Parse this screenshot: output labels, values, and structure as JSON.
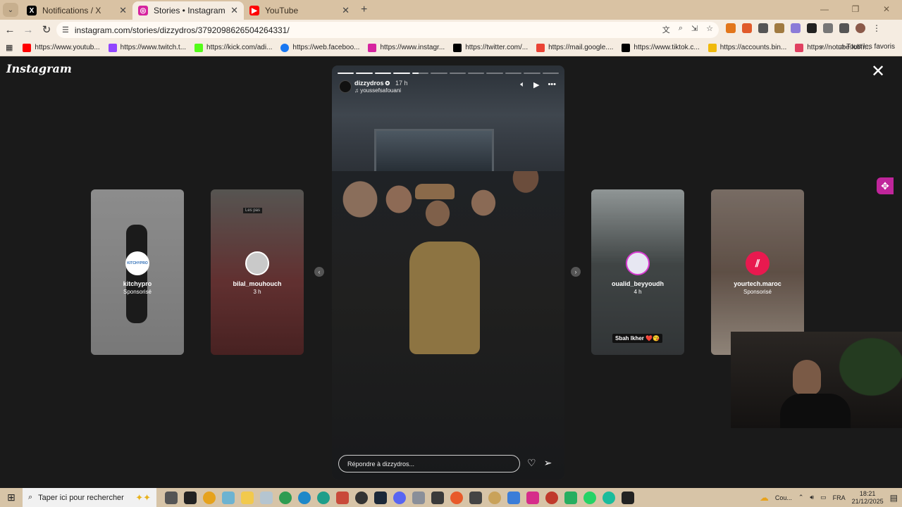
{
  "browser": {
    "tabs": [
      {
        "title": "Notifications / X",
        "icon": "x-logo-icon",
        "color": "#000000",
        "active": false
      },
      {
        "title": "Stories • Instagram",
        "icon": "instagram-icon",
        "color": "#d6249f",
        "active": true
      },
      {
        "title": "YouTube",
        "icon": "youtube-icon",
        "color": "#ff0000",
        "active": false
      }
    ],
    "new_tab": "+",
    "url": "instagram.com/stories/dizzydros/3792098626504264331/",
    "bookmarks": [
      {
        "label": "https://www.youtub...",
        "color": "#ff0000"
      },
      {
        "label": "https://www.twitch.t...",
        "color": "#9146ff"
      },
      {
        "label": "https://kick.com/adi...",
        "color": "#53fc18"
      },
      {
        "label": "https://web.faceboo...",
        "color": "#1877f2"
      },
      {
        "label": "https://www.instagr...",
        "color": "#d6249f"
      },
      {
        "label": "https://twitter.com/...",
        "color": "#000000"
      },
      {
        "label": "https://mail.google....",
        "color": "#ea4335"
      },
      {
        "label": "https://www.tiktok.c...",
        "color": "#000000"
      },
      {
        "label": "https://accounts.bin...",
        "color": "#f0b90b"
      },
      {
        "label": "https://notube.lol/fr...",
        "color": "#e04060"
      }
    ],
    "all_bookmarks": "Tous les favoris"
  },
  "instagram": {
    "logo": "Instagram",
    "story": {
      "username": "dizzydros",
      "time": "17 h",
      "music": "youssefsafouani",
      "reply_placeholder": "Répondre à dizzydros...",
      "progress_segments": [
        1,
        1,
        1,
        1,
        0.4,
        0,
        0,
        0,
        0,
        0,
        0,
        0
      ]
    },
    "cards": [
      {
        "username": "kitchypro",
        "sub": "Sponsorisé",
        "avatar_text": "KITCHYPRO",
        "bg": "#cfcfcf"
      },
      {
        "username": "bilal_mouhouch",
        "sub": "3 h",
        "avatar_text": "",
        "bg": "#8a4a45",
        "overlay_text": "Les pas"
      },
      {
        "username": "oualid_beyyoudh",
        "sub": "4 h",
        "avatar_text": "",
        "bg": "#6a7070",
        "sticker": "Sbah lkher ❤️😘"
      },
      {
        "username": "yourtech.maroc",
        "sub": "Sponsorisé",
        "avatar_text": "",
        "bg": "#8a7566"
      }
    ]
  },
  "taskbar": {
    "search_placeholder": "Taper ici pour rechercher",
    "weather": "Cou...",
    "lang": "FRA",
    "time": "18:21",
    "date": "21/12/2025"
  }
}
